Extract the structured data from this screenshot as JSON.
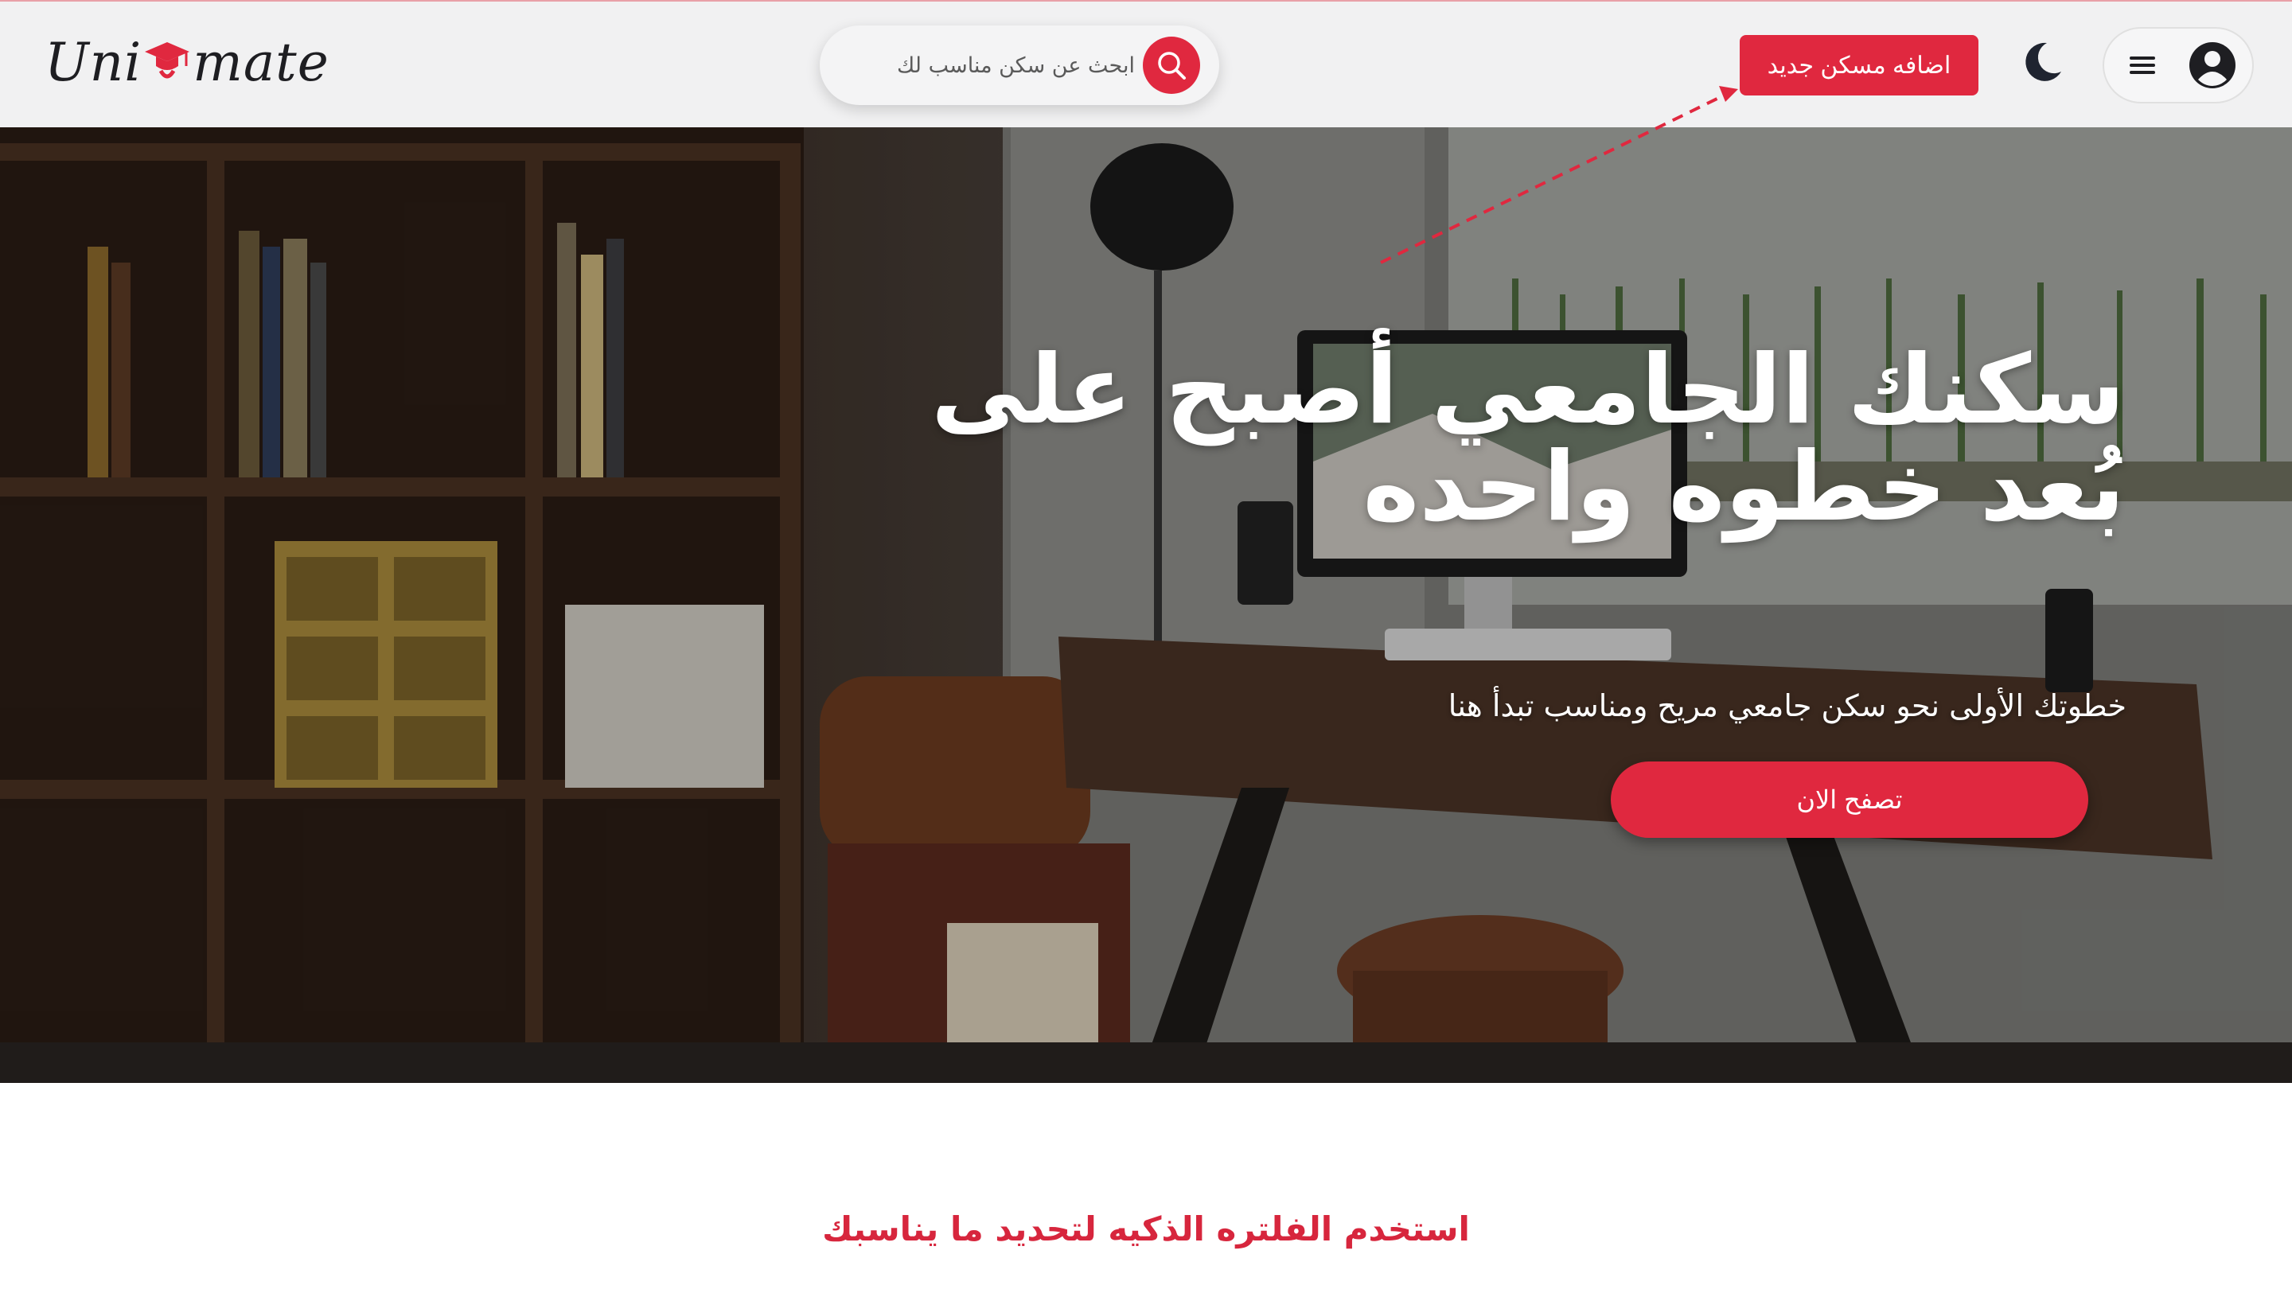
{
  "brand": {
    "logo_left": "Uni",
    "logo_right": "mate",
    "accent_color": "#e0283f"
  },
  "header": {
    "search_placeholder": "ابحث عن سكن مناسب لك",
    "search_icon": "search-icon",
    "add_button_label": "اضافه مسكن جديد",
    "theme_icon": "moon-icon",
    "menu_icon": "hamburger-icon",
    "account_icon": "user-circle-icon"
  },
  "hero": {
    "title": "سكنك الجامعي أصبح على بُعد خطوه واحده",
    "subtitle": "خطوتك الأولى نحو سكن جامعي مريح ومناسب تبدأ هنا",
    "cta_label": "تصفح الان",
    "background": "photo of a home office with bookshelf, desk, monitor and stool"
  },
  "sections": {
    "filter_heading": "استخدم الفلتره الذكيه لتحديد ما يناسبك"
  }
}
